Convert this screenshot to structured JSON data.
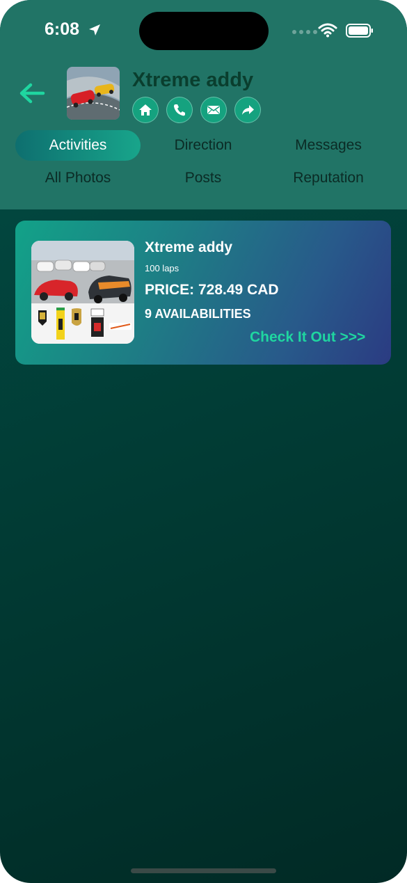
{
  "status_bar": {
    "time": "6:08"
  },
  "header": {
    "title": "Xtreme addy",
    "actions": [
      "home-icon",
      "phone-icon",
      "mail-icon",
      "share-icon"
    ]
  },
  "tabs": [
    {
      "label": "Activities",
      "active": true
    },
    {
      "label": "Direction",
      "active": false
    },
    {
      "label": "Messages",
      "active": false
    },
    {
      "label": "All Photos",
      "active": false
    },
    {
      "label": "Posts",
      "active": false
    },
    {
      "label": "Reputation",
      "active": false
    }
  ],
  "activity_card": {
    "title": "Xtreme addy",
    "subtitle": "100 laps",
    "price": "PRICE: 728.49 CAD",
    "availability": "9 AVAILABILITIES",
    "cta": "Check It Out >>>"
  },
  "colors": {
    "header_bg": "#217466",
    "body_bg": "#013a33",
    "accent": "#1fd6a0",
    "title_text": "#0a3e2e"
  }
}
